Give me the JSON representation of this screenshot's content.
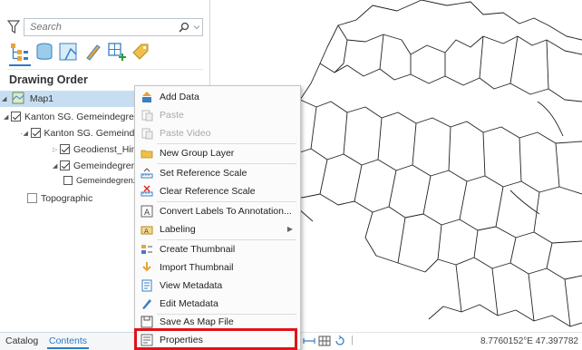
{
  "search": {
    "placeholder": "Search"
  },
  "toolbar": {
    "icons": [
      "list-by-drawing-order-icon",
      "list-by-source-icon",
      "list-by-selection-icon",
      "list-by-editing-icon",
      "list-by-snapping-icon",
      "list-by-labeling-icon"
    ]
  },
  "contents": {
    "heading": "Drawing Order",
    "tree": {
      "map": "Map1",
      "group_layer": "Kanton SG. Gemeindegren",
      "sub_layer": "Kanton SG. Gemeinde",
      "layer_1": "Geodienst_Hinwe",
      "layer_2": "Gemeindegrenze",
      "legend_item": "Gemeindegrenzen",
      "basemap": "Topographic"
    }
  },
  "tabs": {
    "catalog": "Catalog",
    "contents": "Contents"
  },
  "context_menu": {
    "add_data": "Add Data",
    "paste": "Paste",
    "paste_video": "Paste Video",
    "new_group_layer": "New Group Layer",
    "set_reference_scale": "Set Reference Scale",
    "clear_reference_scale": "Clear Reference Scale",
    "convert_labels": "Convert Labels To Annotation...",
    "labeling": "Labeling",
    "create_thumbnail": "Create Thumbnail",
    "import_thumbnail": "Import Thumbnail",
    "view_metadata": "View Metadata",
    "edit_metadata": "Edit Metadata",
    "save_as_map_file": "Save As Map File",
    "properties": "Properties"
  },
  "status": {
    "coordinates": "8.7760152°E 47.397782"
  },
  "colors": {
    "accent": "#2b7ac9",
    "selection": "#c7def2",
    "highlight_border": "#e0121b"
  }
}
